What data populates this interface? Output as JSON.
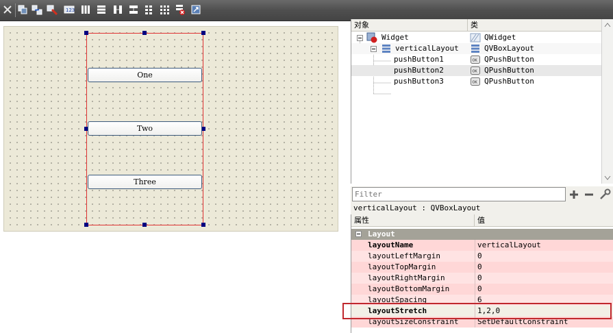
{
  "toolbar": {
    "icons": [
      "close-icon",
      "edit-widgets-icon",
      "edit-signals-icon",
      "edit-buddies-icon",
      "edit-tab-order-icon",
      "layout-horizontal-icon",
      "layout-vertical-icon",
      "layout-horizontal-splitter-icon",
      "layout-vertical-splitter-icon",
      "layout-grid-icon",
      "layout-form-icon",
      "break-layout-icon",
      "adjust-size-icon"
    ]
  },
  "form": {
    "buttons": [
      "One",
      "Two",
      "Three"
    ]
  },
  "object_inspector": {
    "col_object": "对象",
    "col_class": "类",
    "rows": [
      {
        "name": "Widget",
        "class": "QWidget"
      },
      {
        "name": "verticalLayout",
        "class": "QVBoxLayout"
      },
      {
        "name": "pushButton1",
        "class": "QPushButton"
      },
      {
        "name": "pushButton2",
        "class": "QPushButton"
      },
      {
        "name": "pushButton3",
        "class": "QPushButton"
      }
    ]
  },
  "property_editor": {
    "filter_placeholder": "Filter",
    "object_label": "verticalLayout : QVBoxLayout",
    "col_property": "属性",
    "col_value": "值",
    "group": "Layout",
    "rows": [
      {
        "name": "layoutName",
        "value": "verticalLayout"
      },
      {
        "name": "layoutLeftMargin",
        "value": "0"
      },
      {
        "name": "layoutTopMargin",
        "value": "0"
      },
      {
        "name": "layoutRightMargin",
        "value": "0"
      },
      {
        "name": "layoutBottomMargin",
        "value": "0"
      },
      {
        "name": "layoutSpacing",
        "value": "6"
      },
      {
        "name": "layoutStretch",
        "value": "1,2,0"
      },
      {
        "name": "layoutSizeConstraint",
        "value": "SetDefaultConstraint"
      }
    ]
  },
  "colors": {
    "highlight": "#c0272d",
    "layout_frame": "#e03030",
    "handle": "#000080"
  }
}
